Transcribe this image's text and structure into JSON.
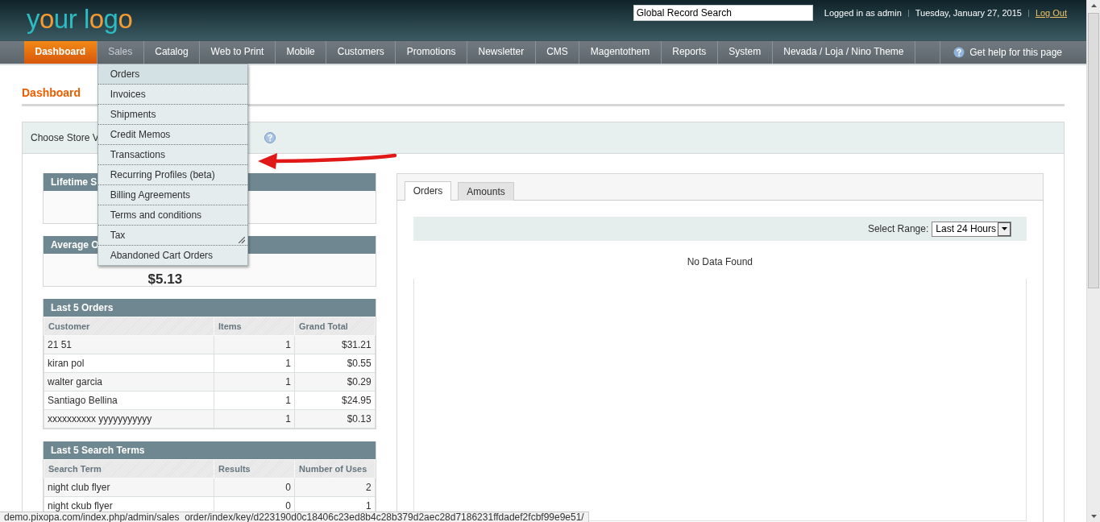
{
  "header": {
    "logo": "your logo",
    "search": {
      "value": "Global Record Search"
    },
    "user": "Logged in as admin",
    "date": "Tuesday, January 27, 2015",
    "logout": "Log Out"
  },
  "nav": {
    "items": [
      {
        "label": "Dashboard",
        "selected": true,
        "expanded": false
      },
      {
        "label": "Sales",
        "selected": false,
        "expanded": true,
        "menu": [
          {
            "label": "Orders",
            "selected": true
          },
          {
            "label": "Invoices",
            "selected": false
          },
          {
            "label": "Shipments",
            "selected": false
          },
          {
            "label": "Credit Memos",
            "selected": false
          },
          {
            "label": "Transactions",
            "selected": false
          },
          {
            "label": "Recurring Profiles (beta)",
            "selected": false
          },
          {
            "label": "Billing Agreements",
            "selected": false
          },
          {
            "label": "Terms and conditions",
            "selected": false
          },
          {
            "label": "Tax",
            "selected": false
          },
          {
            "label": "Abandoned Cart Orders",
            "selected": false
          }
        ]
      },
      {
        "label": "Catalog",
        "selected": false,
        "expanded": false
      },
      {
        "label": "Web to Print",
        "selected": false,
        "expanded": false
      },
      {
        "label": "Mobile",
        "selected": false,
        "expanded": false
      },
      {
        "label": "Customers",
        "selected": false,
        "expanded": false
      },
      {
        "label": "Promotions",
        "selected": false,
        "expanded": false
      },
      {
        "label": "Newsletter",
        "selected": false,
        "expanded": false
      },
      {
        "label": "CMS",
        "selected": false,
        "expanded": false
      },
      {
        "label": "Magentothem",
        "selected": false,
        "expanded": false
      },
      {
        "label": "Reports",
        "selected": false,
        "expanded": false
      },
      {
        "label": "System",
        "selected": false,
        "expanded": false
      },
      {
        "label": "Nevada / Loja / Nino Theme",
        "selected": false,
        "expanded": false
      }
    ],
    "help": "Get help for this page"
  },
  "page_title": "Dashboard",
  "store_switcher": {
    "label": "Choose Store V"
  },
  "lifetime_sales": {
    "title": "Lifetime S"
  },
  "average_orders": {
    "title": "Average O",
    "value": "$5.13"
  },
  "last_orders": {
    "title": "Last 5 Orders",
    "columns": [
      "Customer",
      "Items",
      "Grand Total"
    ],
    "rows": [
      [
        "21 51",
        "1",
        "$31.21"
      ],
      [
        "kiran pol",
        "1",
        "$0.55"
      ],
      [
        "walter garcia",
        "1",
        "$0.29"
      ],
      [
        "Santiago Bellina",
        "1",
        "$24.95"
      ],
      [
        "xxxxxxxxxx yyyyyyyyyyy",
        "1",
        "$0.13"
      ]
    ]
  },
  "last_search_terms": {
    "title": "Last 5 Search Terms",
    "columns": [
      "Search Term",
      "Results",
      "Number of Uses"
    ],
    "rows": [
      [
        "night club flyer",
        "0",
        "2"
      ],
      [
        "night ckub flyer",
        "0",
        "1"
      ]
    ]
  },
  "chart_panel": {
    "tabs": [
      {
        "label": "Orders",
        "selected": true
      },
      {
        "label": "Amounts",
        "selected": false
      }
    ],
    "range_label": "Select Range:",
    "range_value": "Last 24 Hours",
    "empty_text": "No Data Found"
  },
  "status_bar": "demo.pixopa.com/index.php/admin/sales_order/index/key/d223190d0c18406c23ed8b4c28b379d2aec28d7186231ffdadef2fcbf99e9e51/"
}
